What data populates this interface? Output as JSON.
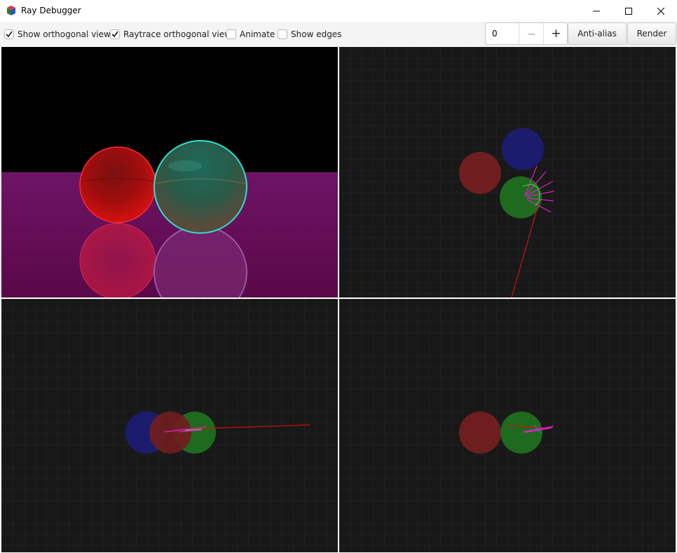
{
  "window": {
    "title": "Ray Debugger"
  },
  "toolbar": {
    "checkboxes": [
      {
        "label": "Show orthogonal views",
        "checked": true
      },
      {
        "label": "Raytrace orthogonal views",
        "checked": true
      },
      {
        "label": "Animate",
        "checked": false
      },
      {
        "label": "Show edges",
        "checked": false
      }
    ],
    "spinner": {
      "value": "0",
      "minus": "−",
      "plus": "+"
    },
    "anti_alias_label": "Anti-alias",
    "render_label": "Render"
  },
  "colors": {
    "sky": "#000000",
    "floor": "#6a0f58",
    "red_sphere": "#b31a1a",
    "green_sphere": "#1e7a2a",
    "blue_sphere": "#1a1a80",
    "ray_red": "#e01818",
    "ray_magenta": "#ff2fd2",
    "ortho_bg": "#181818"
  }
}
